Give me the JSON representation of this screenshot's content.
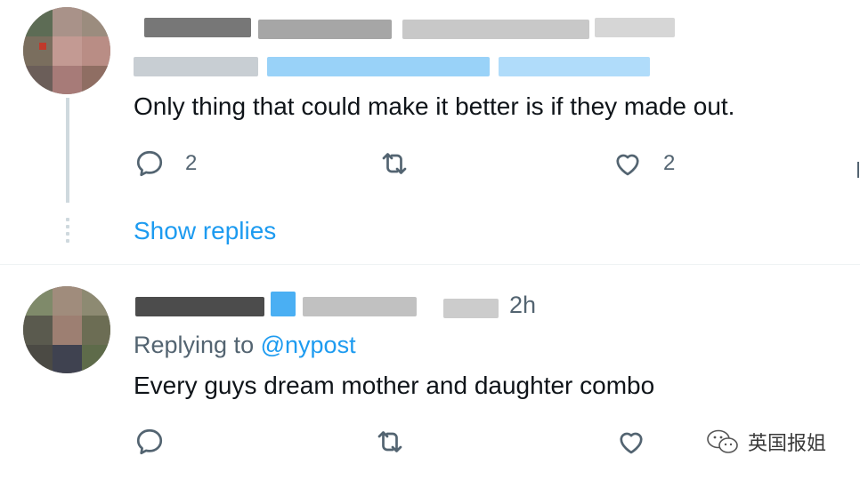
{
  "tweets": [
    {
      "meta_visible": "",
      "replying_prefix": "",
      "text": "Only thing that could make it better is if they made out.",
      "actions": {
        "reply_count": "2",
        "retweet_count": "",
        "like_count": "2"
      }
    },
    {
      "time": "2h",
      "replying_prefix": "Replying to",
      "replying_handle": "@nypost",
      "text": "Every guys dream mother and daughter combo",
      "actions": {
        "reply_count": "",
        "retweet_count": "",
        "like_count": ""
      }
    }
  ],
  "show_replies_label": "Show replies",
  "watermark": {
    "text": "英国报姐",
    "icon": "wechat-icon"
  },
  "icons": {
    "reply": "reply-icon",
    "retweet": "retweet-icon",
    "like": "like-icon",
    "verified": "verified-badge-icon"
  },
  "colors": {
    "link": "#1d9bf0",
    "secondary_text": "#536471",
    "primary_text": "#0f1419",
    "thread_line": "#cfd9de"
  }
}
